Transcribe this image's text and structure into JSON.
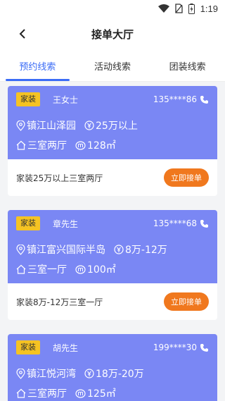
{
  "status_bar": {
    "time": "1:19"
  },
  "header": {
    "title": "接单大厅"
  },
  "tabs": [
    {
      "label": "预约线索",
      "active": true
    },
    {
      "label": "活动线索",
      "active": false
    },
    {
      "label": "团装线索",
      "active": false
    }
  ],
  "cards": [
    {
      "tag": "家装",
      "name": "王女士",
      "phone": "135****86",
      "location": "镇江山泽园",
      "budget": "25万以上",
      "layout": "三室两厅",
      "area": "128㎡",
      "summary": "家装25万以上三室两厅",
      "action": "立即接单"
    },
    {
      "tag": "家装",
      "name": "章先生",
      "phone": "135****68",
      "location": "镇江富兴国际半岛",
      "budget": "8万-12万",
      "layout": "三室一厅",
      "area": "100㎡",
      "summary": "家装8万-12万三室一厅",
      "action": "立即接单"
    },
    {
      "tag": "家装",
      "name": "胡先生",
      "phone": "199****30",
      "location": "镇江悦河湾",
      "budget": "18万-20万",
      "layout": "三室两厅",
      "area": "125㎡",
      "summary": "",
      "action": ""
    }
  ],
  "colors": {
    "accent": "#3b6cf6",
    "card_header": "#7a87f4",
    "tag": "#f5c323",
    "button": "#f0781e"
  }
}
